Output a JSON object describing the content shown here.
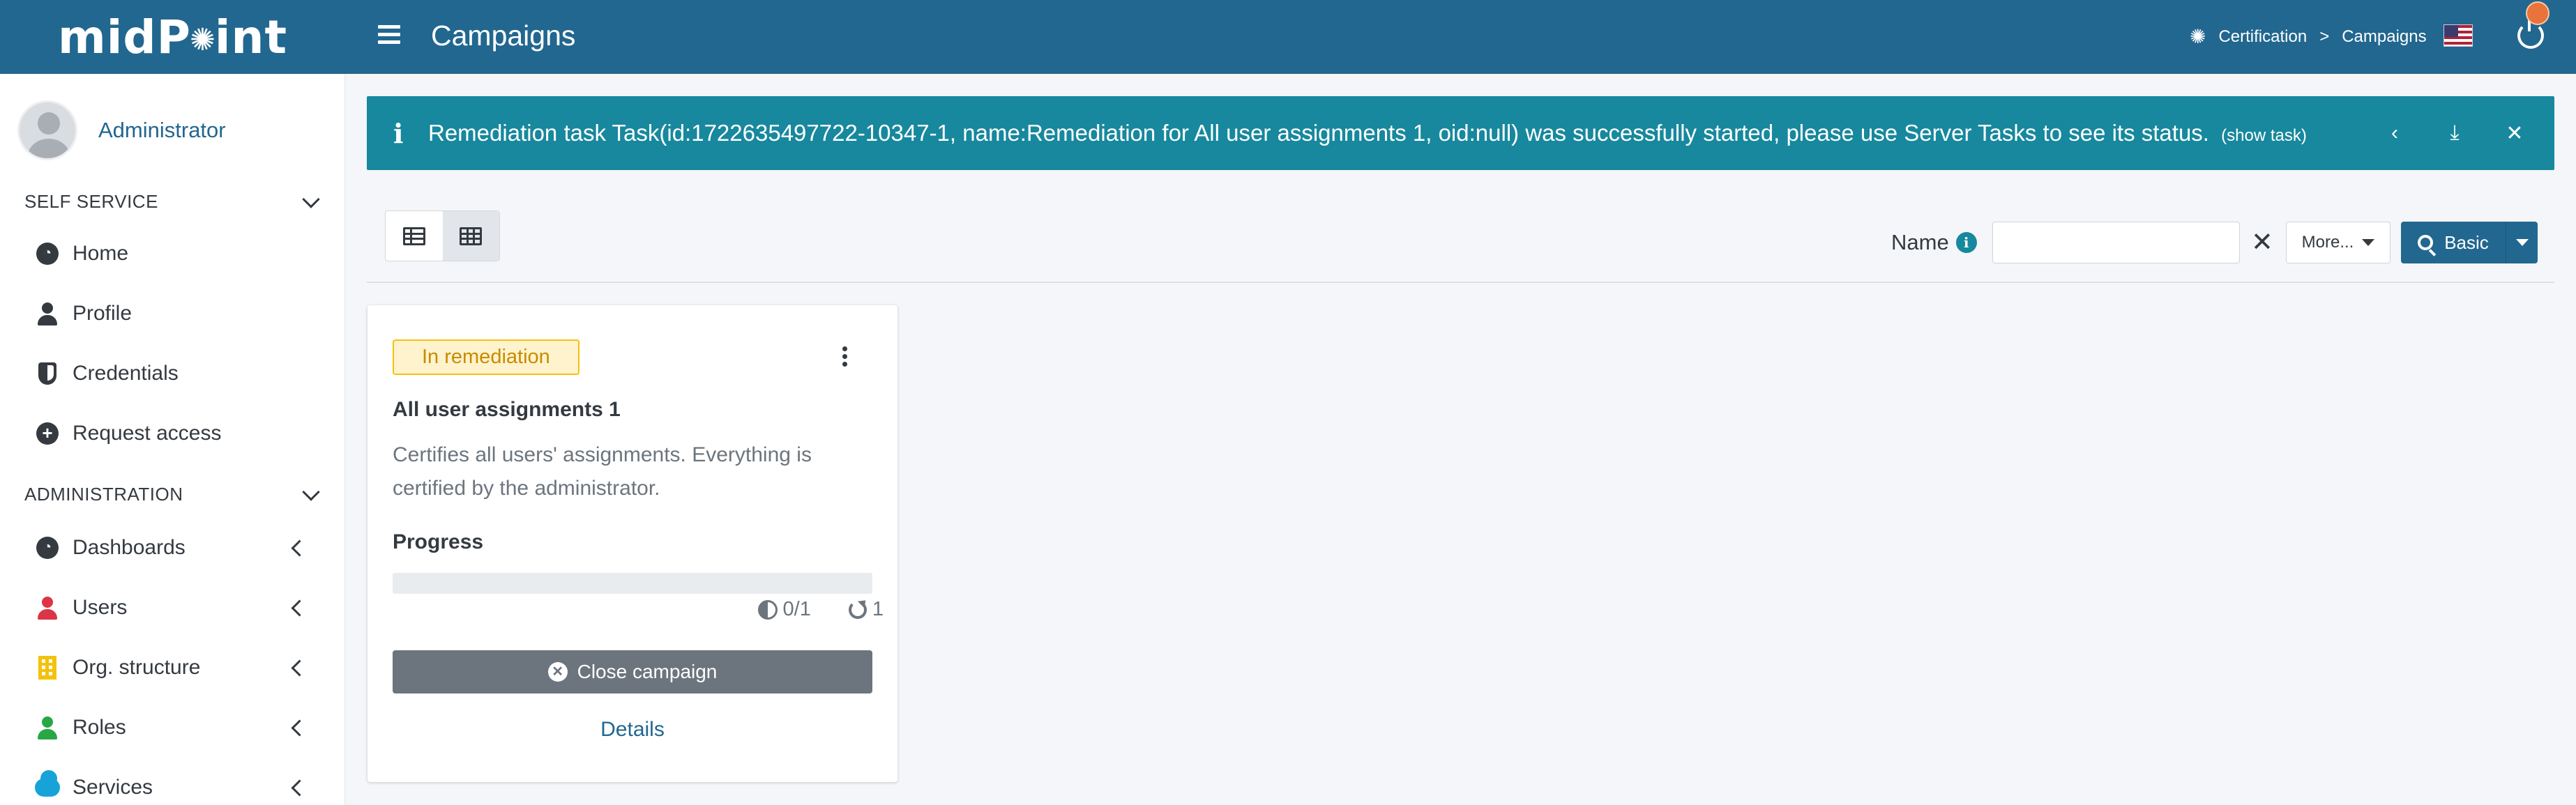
{
  "header": {
    "logo_text": "midPoint",
    "page_title": "Campaigns",
    "breadcrumb": [
      "Certification",
      "Campaigns"
    ],
    "breadcrumb_separator": ">"
  },
  "sidebar": {
    "user_name": "Administrator",
    "sections": [
      {
        "title": "SELF SERVICE",
        "items": [
          {
            "label": "Home",
            "icon": "dashboard-icon"
          },
          {
            "label": "Profile",
            "icon": "user-icon"
          },
          {
            "label": "Credentials",
            "icon": "shield-icon"
          },
          {
            "label": "Request access",
            "icon": "plus-circle-icon"
          }
        ]
      },
      {
        "title": "ADMINISTRATION",
        "items": [
          {
            "label": "Dashboards",
            "icon": "dashboard-icon"
          },
          {
            "label": "Users",
            "icon": "user-icon",
            "color": "#dc3545"
          },
          {
            "label": "Org. structure",
            "icon": "building-icon",
            "color": "#f4c20d"
          },
          {
            "label": "Roles",
            "icon": "role-icon",
            "color": "#28a745"
          },
          {
            "label": "Services",
            "icon": "cloud-icon",
            "color": "#17a2d8"
          }
        ]
      }
    ]
  },
  "alert": {
    "message": "Remediation task Task(id:1722635497722-10347-1, name:Remediation for All user assignments 1, oid:null) was successfully started, please use Server Tasks to see its status.",
    "link_text": "(show task)",
    "color": "#17889d"
  },
  "toolbar": {
    "search_label": "Name",
    "search_value": "",
    "more_label": "More...",
    "basic_label": "Basic"
  },
  "campaign_card": {
    "status_badge": "In remediation",
    "title": "All user assignments 1",
    "description": "Certifies all users' assignments. Everything is certified by the administrator.",
    "progress_label": "Progress",
    "progress_fraction": 0,
    "completion": "0/1",
    "iteration": "1",
    "close_label": "Close campaign",
    "details_label": "Details"
  },
  "colors": {
    "primary": "#22678f",
    "info": "#17889d",
    "warning": "#f4c20d",
    "secondary": "#6c757d"
  }
}
